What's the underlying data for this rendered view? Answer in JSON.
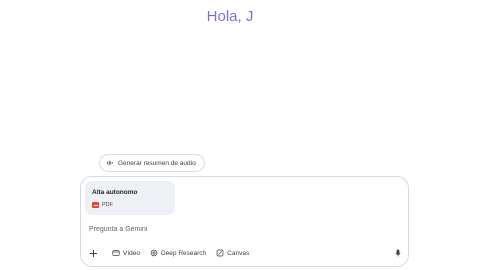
{
  "greeting": "Hola, J",
  "suggestion_chip": {
    "label": "Generar resumen de audio",
    "icon": "audio-waveform-icon"
  },
  "attachment": {
    "name": "Alta autonomo",
    "type_label": "PDF",
    "icon": "pdf-icon"
  },
  "prompt": {
    "placeholder": "Pregunta a Gemini"
  },
  "toolbar": {
    "add_icon": "plus-icon",
    "tools": [
      {
        "label": "Vídeo",
        "icon": "video-icon"
      },
      {
        "label": "Deep Research",
        "icon": "deep-research-icon"
      },
      {
        "label": "Canvas",
        "icon": "canvas-icon"
      }
    ],
    "mic_icon": "microphone-icon"
  },
  "colors": {
    "greeting_start": "#4f7fd9",
    "greeting_end": "#c06b9a",
    "pdf_red": "#ea4335"
  }
}
